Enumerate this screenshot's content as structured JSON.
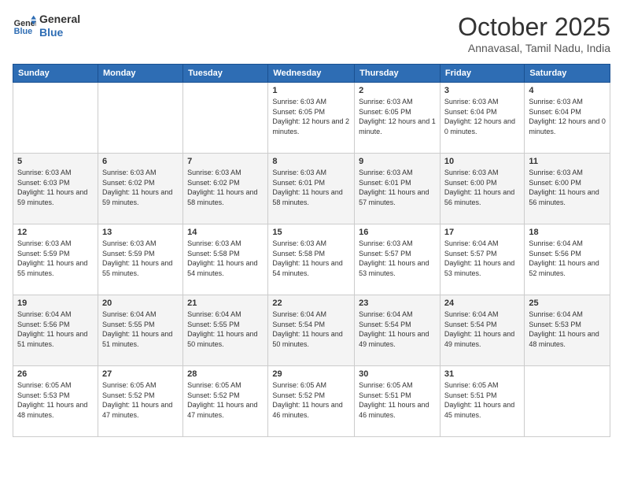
{
  "header": {
    "logo_line1": "General",
    "logo_line2": "Blue",
    "month": "October 2025",
    "location": "Annavasal, Tamil Nadu, India"
  },
  "days_of_week": [
    "Sunday",
    "Monday",
    "Tuesday",
    "Wednesday",
    "Thursday",
    "Friday",
    "Saturday"
  ],
  "weeks": [
    [
      {
        "num": "",
        "info": ""
      },
      {
        "num": "",
        "info": ""
      },
      {
        "num": "",
        "info": ""
      },
      {
        "num": "1",
        "info": "Sunrise: 6:03 AM\nSunset: 6:05 PM\nDaylight: 12 hours\nand 2 minutes."
      },
      {
        "num": "2",
        "info": "Sunrise: 6:03 AM\nSunset: 6:05 PM\nDaylight: 12 hours\nand 1 minute."
      },
      {
        "num": "3",
        "info": "Sunrise: 6:03 AM\nSunset: 6:04 PM\nDaylight: 12 hours\nand 0 minutes."
      },
      {
        "num": "4",
        "info": "Sunrise: 6:03 AM\nSunset: 6:04 PM\nDaylight: 12 hours\nand 0 minutes."
      }
    ],
    [
      {
        "num": "5",
        "info": "Sunrise: 6:03 AM\nSunset: 6:03 PM\nDaylight: 11 hours\nand 59 minutes."
      },
      {
        "num": "6",
        "info": "Sunrise: 6:03 AM\nSunset: 6:02 PM\nDaylight: 11 hours\nand 59 minutes."
      },
      {
        "num": "7",
        "info": "Sunrise: 6:03 AM\nSunset: 6:02 PM\nDaylight: 11 hours\nand 58 minutes."
      },
      {
        "num": "8",
        "info": "Sunrise: 6:03 AM\nSunset: 6:01 PM\nDaylight: 11 hours\nand 58 minutes."
      },
      {
        "num": "9",
        "info": "Sunrise: 6:03 AM\nSunset: 6:01 PM\nDaylight: 11 hours\nand 57 minutes."
      },
      {
        "num": "10",
        "info": "Sunrise: 6:03 AM\nSunset: 6:00 PM\nDaylight: 11 hours\nand 56 minutes."
      },
      {
        "num": "11",
        "info": "Sunrise: 6:03 AM\nSunset: 6:00 PM\nDaylight: 11 hours\nand 56 minutes."
      }
    ],
    [
      {
        "num": "12",
        "info": "Sunrise: 6:03 AM\nSunset: 5:59 PM\nDaylight: 11 hours\nand 55 minutes."
      },
      {
        "num": "13",
        "info": "Sunrise: 6:03 AM\nSunset: 5:59 PM\nDaylight: 11 hours\nand 55 minutes."
      },
      {
        "num": "14",
        "info": "Sunrise: 6:03 AM\nSunset: 5:58 PM\nDaylight: 11 hours\nand 54 minutes."
      },
      {
        "num": "15",
        "info": "Sunrise: 6:03 AM\nSunset: 5:58 PM\nDaylight: 11 hours\nand 54 minutes."
      },
      {
        "num": "16",
        "info": "Sunrise: 6:03 AM\nSunset: 5:57 PM\nDaylight: 11 hours\nand 53 minutes."
      },
      {
        "num": "17",
        "info": "Sunrise: 6:04 AM\nSunset: 5:57 PM\nDaylight: 11 hours\nand 53 minutes."
      },
      {
        "num": "18",
        "info": "Sunrise: 6:04 AM\nSunset: 5:56 PM\nDaylight: 11 hours\nand 52 minutes."
      }
    ],
    [
      {
        "num": "19",
        "info": "Sunrise: 6:04 AM\nSunset: 5:56 PM\nDaylight: 11 hours\nand 51 minutes."
      },
      {
        "num": "20",
        "info": "Sunrise: 6:04 AM\nSunset: 5:55 PM\nDaylight: 11 hours\nand 51 minutes."
      },
      {
        "num": "21",
        "info": "Sunrise: 6:04 AM\nSunset: 5:55 PM\nDaylight: 11 hours\nand 50 minutes."
      },
      {
        "num": "22",
        "info": "Sunrise: 6:04 AM\nSunset: 5:54 PM\nDaylight: 11 hours\nand 50 minutes."
      },
      {
        "num": "23",
        "info": "Sunrise: 6:04 AM\nSunset: 5:54 PM\nDaylight: 11 hours\nand 49 minutes."
      },
      {
        "num": "24",
        "info": "Sunrise: 6:04 AM\nSunset: 5:54 PM\nDaylight: 11 hours\nand 49 minutes."
      },
      {
        "num": "25",
        "info": "Sunrise: 6:04 AM\nSunset: 5:53 PM\nDaylight: 11 hours\nand 48 minutes."
      }
    ],
    [
      {
        "num": "26",
        "info": "Sunrise: 6:05 AM\nSunset: 5:53 PM\nDaylight: 11 hours\nand 48 minutes."
      },
      {
        "num": "27",
        "info": "Sunrise: 6:05 AM\nSunset: 5:52 PM\nDaylight: 11 hours\nand 47 minutes."
      },
      {
        "num": "28",
        "info": "Sunrise: 6:05 AM\nSunset: 5:52 PM\nDaylight: 11 hours\nand 47 minutes."
      },
      {
        "num": "29",
        "info": "Sunrise: 6:05 AM\nSunset: 5:52 PM\nDaylight: 11 hours\nand 46 minutes."
      },
      {
        "num": "30",
        "info": "Sunrise: 6:05 AM\nSunset: 5:51 PM\nDaylight: 11 hours\nand 46 minutes."
      },
      {
        "num": "31",
        "info": "Sunrise: 6:05 AM\nSunset: 5:51 PM\nDaylight: 11 hours\nand 45 minutes."
      },
      {
        "num": "",
        "info": ""
      }
    ]
  ]
}
